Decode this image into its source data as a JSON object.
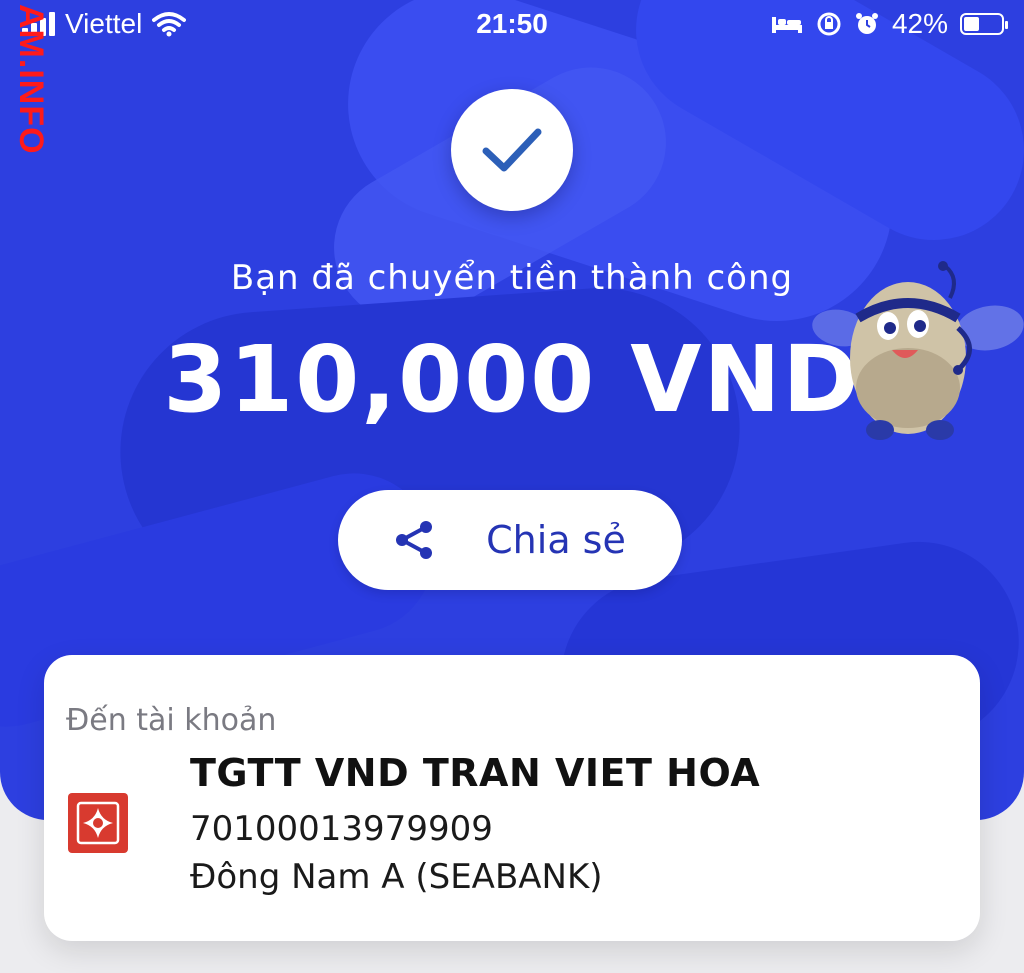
{
  "status_bar": {
    "carrier": "Viettel",
    "time": "21:50",
    "battery_percent": "42%",
    "battery_level": 0.42,
    "icons": [
      "signal-icon",
      "wifi-icon",
      "bed-icon",
      "rotation-lock-icon",
      "alarm-icon",
      "battery-icon"
    ]
  },
  "watermark": {
    "text": "AM.INFO"
  },
  "result": {
    "icon": "checkmark-icon",
    "message": "Bạn đã chuyển tiền thành công",
    "amount": "310,000 VND"
  },
  "share": {
    "icon": "share-icon",
    "label": "Chia sẻ"
  },
  "recipient": {
    "title": "Đến tài khoản",
    "account_name": "TGTT VND TRAN VIET HOA",
    "account_number": "70100013979909",
    "bank_name": "Đông Nam A (SEABANK)",
    "bank_logo_icon": "seabank-logo-icon"
  },
  "colors": {
    "hero_blue": "#2d3fe0",
    "share_text": "#2534b4",
    "check": "#2c5fb8",
    "watermark": "#ff1a1a",
    "bank_logo": "#d83a2f"
  }
}
